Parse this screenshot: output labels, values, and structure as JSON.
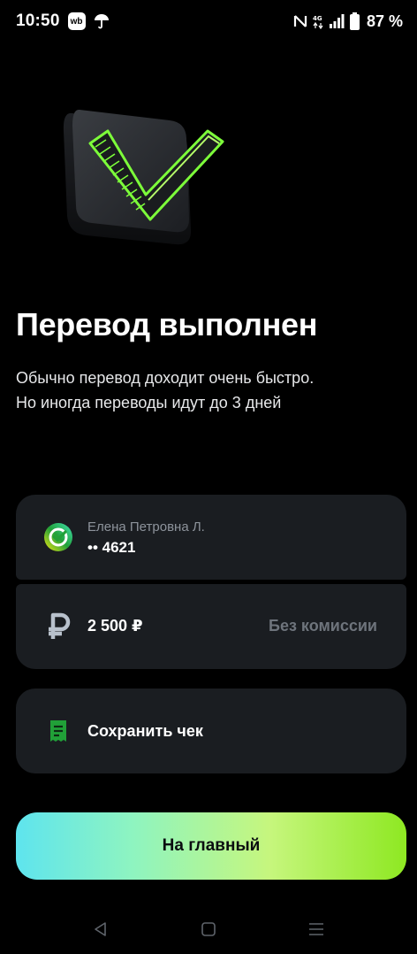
{
  "status": {
    "time": "10:50",
    "app_badge": "wb",
    "battery": "87 %",
    "icons": [
      "wb-icon",
      "umbrella-icon",
      "nfc-icon",
      "lte-icon",
      "signal-icon",
      "battery-icon"
    ]
  },
  "title": "Перевод выполнен",
  "subtitle": {
    "line1": "Обычно перевод доходит очень быстро.",
    "line2": "Но иногда переводы идут до 3 дней"
  },
  "recipient": {
    "name": "Елена Петровна Л.",
    "account": "•• 4621",
    "icon": "sber-icon"
  },
  "transfer": {
    "amount": "2 500 ₽",
    "commission": "Без комиссии",
    "icon": "ruble-icon"
  },
  "receipt": {
    "label": "Сохранить чек",
    "icon": "receipt-icon"
  },
  "main_button": {
    "label": "На главный"
  },
  "colors": {
    "background": "#000000",
    "card": "#1a1d21",
    "accent_green": "#21a038",
    "muted_text": "#6e747c"
  }
}
